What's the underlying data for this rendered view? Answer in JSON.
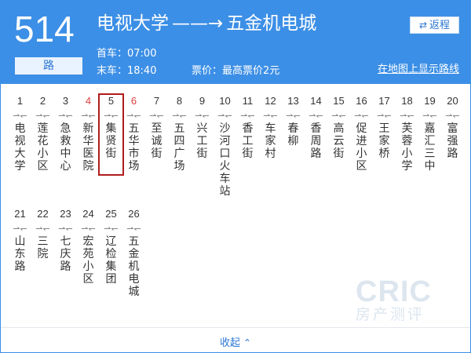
{
  "route": {
    "number": "514",
    "suffix": "路",
    "from": "电视大学",
    "arrow": "——→",
    "to": "五金机电城",
    "first_bus": "首车：07:00",
    "last_bus": "末车：18:40",
    "fare": "票价：最高票价2元",
    "map_link": "在地图上显示路线",
    "return_label": "返程",
    "return_icon": "⇄"
  },
  "stops": [
    {
      "num": "1",
      "dir": "⇀↽",
      "name": "电视大学"
    },
    {
      "num": "2",
      "dir": "⇀↽",
      "name": "莲花小区"
    },
    {
      "num": "3",
      "dir": "⇀↽",
      "name": "急救中心"
    },
    {
      "num": "4",
      "dir": "⇀↽",
      "name": "新华医院"
    },
    {
      "num": "5",
      "dir": "⇀↽",
      "name": "集贤街"
    },
    {
      "num": "6",
      "dir": "⇀↽",
      "name": "五华市场"
    },
    {
      "num": "7",
      "dir": "⇀↽",
      "name": "至诚街"
    },
    {
      "num": "8",
      "dir": "⇀↽",
      "name": "五四广场"
    },
    {
      "num": "9",
      "dir": "⇀↽",
      "name": "兴工街"
    },
    {
      "num": "10",
      "dir": "⇀↽",
      "name": "沙河口火车站"
    },
    {
      "num": "11",
      "dir": "⇀↽",
      "name": "香工街"
    },
    {
      "num": "12",
      "dir": "⇀↽",
      "name": "车家村"
    },
    {
      "num": "13",
      "dir": "⇀↽",
      "name": "春柳"
    },
    {
      "num": "14",
      "dir": "⇀↽",
      "name": "香周路"
    },
    {
      "num": "15",
      "dir": "⇀↽",
      "name": "高云街"
    },
    {
      "num": "16",
      "dir": "⇀↽",
      "name": "促进小区"
    },
    {
      "num": "17",
      "dir": "⇀↽",
      "name": "王家桥"
    },
    {
      "num": "18",
      "dir": "⇀↽",
      "name": "芙蓉小学"
    },
    {
      "num": "19",
      "dir": "⇀↽",
      "name": "嘉汇三中"
    },
    {
      "num": "20",
      "dir": "⇀↽",
      "name": "富强路"
    },
    {
      "num": "21",
      "dir": "⇀↽",
      "name": "山东路"
    },
    {
      "num": "22",
      "dir": "⇀↽",
      "name": "三院"
    },
    {
      "num": "23",
      "dir": "⇀↽",
      "name": "七庆路"
    },
    {
      "num": "24",
      "dir": "⇀↽",
      "name": "宏苑小区"
    },
    {
      "num": "25",
      "dir": "⇀↽",
      "name": "辽检集团"
    },
    {
      "num": "26",
      "dir": "⇀↽",
      "name": "五金机电城"
    }
  ],
  "passed_stops": [
    "4",
    "6"
  ],
  "selected_stop": "5",
  "watermark": {
    "top": "CRIC",
    "bottom": "房产测评"
  },
  "footer": {
    "collapse_label": "收起",
    "collapse_icon": "⌃"
  },
  "colors": {
    "header_bg": "#3c8fe6",
    "link": "#2a76d2",
    "passed": "#e04040",
    "selected_border": "#b01c1c"
  }
}
